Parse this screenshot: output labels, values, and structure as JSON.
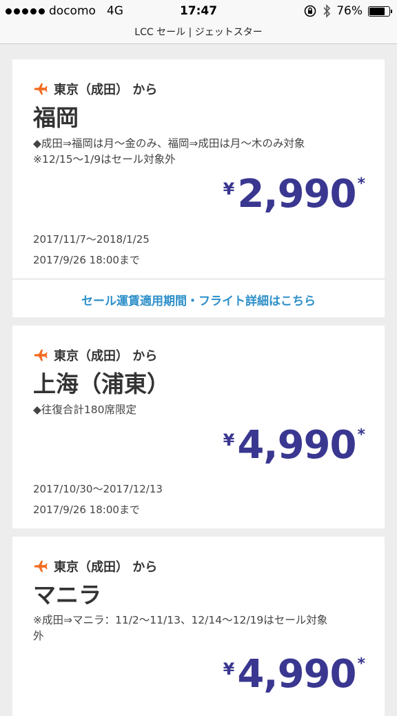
{
  "status_bar": {
    "carrier": "docomo",
    "network": "4G",
    "time": "17:47",
    "battery": "76%"
  },
  "nav": {
    "title": "LCC セール | ジェットスター"
  },
  "cards": [
    {
      "route": "東京（成田） から",
      "destination": "福岡",
      "note_line1": "◆成田⇒福岡は月〜金のみ、福岡⇒成田は月〜木のみ対象",
      "note_line2": "※12/15〜1/9はセール対象外",
      "price_currency": "¥",
      "price": "2,990",
      "price_mark": "*",
      "travel_period": "2017/11/7〜2018/1/25",
      "sale_deadline": "2017/9/26 18:00まで",
      "detail_link": "セール運賃適用期間・フライト詳細はこちら"
    },
    {
      "route": "東京（成田） から",
      "destination": "上海（浦東）",
      "note_line1": "◆往復合計180席限定",
      "price_currency": "¥",
      "price": "4,990",
      "price_mark": "*",
      "travel_period": "2017/10/30〜2017/12/13",
      "sale_deadline": "2017/9/26 18:00まで"
    },
    {
      "route": "東京（成田） から",
      "destination": "マニラ",
      "note_line1": "※成田⇒マニラ：11/2〜11/13、12/14〜12/19はセール対象",
      "note_line2": "外",
      "price_currency": "¥",
      "price": "4,990",
      "price_mark": "*"
    }
  ],
  "colors": {
    "accent_orange": "#f26b21",
    "price_purple": "#3a3791",
    "link_blue": "#2d8fc9"
  },
  "icons": {
    "route_icon": "airplane-icon"
  }
}
